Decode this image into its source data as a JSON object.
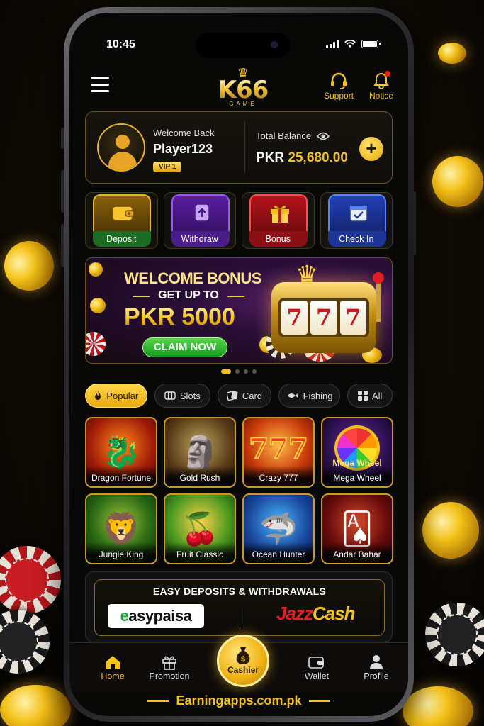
{
  "status_bar": {
    "time": "10:45"
  },
  "header": {
    "logo_text": "K66",
    "logo_sub": "GAME",
    "support_label": "Support",
    "notice_label": "Notice"
  },
  "account": {
    "welcome": "Welcome Back",
    "username": "Player123",
    "vip": "VIP 1",
    "balance_label": "Total Balance",
    "currency": "PKR",
    "balance": "25,680.00"
  },
  "quick_actions": [
    {
      "label": "Deposit",
      "icon": "wallet-icon"
    },
    {
      "label": "Withdraw",
      "icon": "withdraw-icon"
    },
    {
      "label": "Bonus",
      "icon": "gift-icon"
    },
    {
      "label": "Check In",
      "icon": "calendar-check-icon"
    }
  ],
  "banner": {
    "title": "WELCOME BONUS",
    "subtitle": "GET UP TO",
    "amount": "PKR 5000",
    "cta": "CLAIM NOW",
    "reels": [
      "7",
      "7",
      "7"
    ],
    "slide_count": 4,
    "active_slide": 1
  },
  "categories": [
    {
      "label": "Popular",
      "icon": "flame-icon",
      "active": true
    },
    {
      "label": "Slots",
      "icon": "slot-icon"
    },
    {
      "label": "Card",
      "icon": "cards-icon"
    },
    {
      "label": "Fishing",
      "icon": "fish-icon"
    },
    {
      "label": "All",
      "icon": "grid-icon"
    }
  ],
  "games": [
    {
      "name": "Dragon Fortune",
      "icon": "dragon-icon"
    },
    {
      "name": "Gold Rush",
      "icon": "golden-mask-icon"
    },
    {
      "name": "Crazy 777",
      "icon": "seven-icon"
    },
    {
      "name": "Mega Wheel",
      "icon": "wheel-icon",
      "art_title": "Mega Wheel"
    },
    {
      "name": "Jungle King",
      "icon": "lion-icon"
    },
    {
      "name": "Fruit Classic",
      "icon": "fruit-icon"
    },
    {
      "name": "Ocean Hunter",
      "icon": "shark-icon"
    },
    {
      "name": "Andar Bahar",
      "icon": "playing-cards-icon"
    }
  ],
  "payments": {
    "title": "EASY DEPOSITS & WITHDRAWALS",
    "easypaisa_e": "e",
    "easypaisa_rest": "asypaisa",
    "jazz": "Jazz",
    "cash": "Cash"
  },
  "bottom_nav": {
    "home": "Home",
    "promotion": "Promotion",
    "cashier": "Cashier",
    "wallet": "Wallet",
    "profile": "Profile"
  },
  "footer": "Earningapps.com.pk",
  "colors": {
    "accent": "#f4c21a",
    "background": "#080807",
    "notice_dot": "#e21d26"
  }
}
